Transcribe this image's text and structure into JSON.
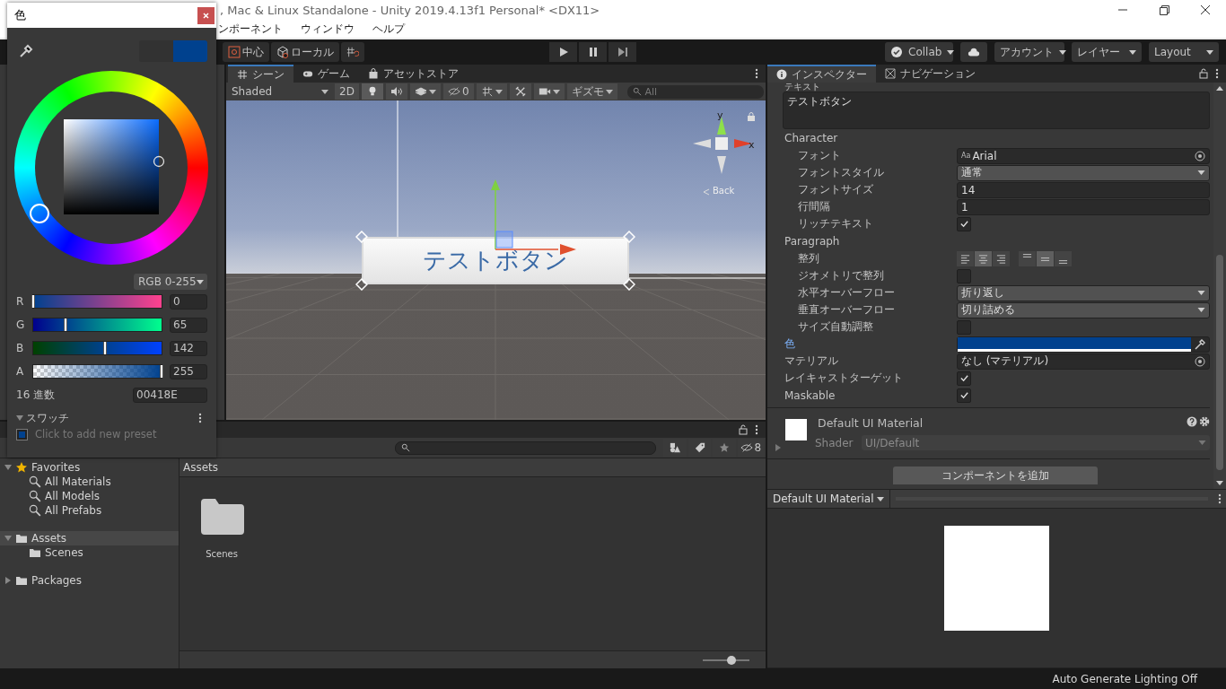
{
  "title_bar": {
    "title": ", Mac & Linux Standalone - Unity 2019.4.13f1 Personal* <DX11>"
  },
  "menu_bar": [
    "ンポーネント",
    "ウィンドウ",
    "ヘルプ"
  ],
  "toolbar": {
    "tools": [
      {
        "label": "中心",
        "kind": "pivot"
      },
      {
        "label": "ローカル",
        "kind": "space"
      }
    ],
    "collab": "Collab",
    "account": "アカウント",
    "layers": "レイヤー",
    "layout": "Layout"
  },
  "scene": {
    "tabs": [
      {
        "label": "シーン",
        "kind": "scene",
        "selected": true
      },
      {
        "label": "ゲーム",
        "kind": "game",
        "selected": false
      },
      {
        "label": "アセットストア",
        "kind": "store",
        "selected": false
      }
    ],
    "shading": "Shaded",
    "mode_2d": "2D",
    "hidden_count": "0",
    "gizmos": "ギズモ",
    "search_placeholder": "All",
    "axis_y": "y",
    "axis_x": "x",
    "view_label": "Back",
    "button_text": "テストボタン"
  },
  "project": {
    "hidden_count": "8",
    "tree": [
      {
        "label": "Favorites",
        "kind": "favorites",
        "expanded": true,
        "selected": false,
        "children": [
          {
            "label": "All Materials",
            "kind": "search",
            "selected": false
          },
          {
            "label": "All Models",
            "kind": "search",
            "selected": false
          },
          {
            "label": "All Prefabs",
            "kind": "search",
            "selected": false
          }
        ]
      },
      {
        "label": "Assets",
        "kind": "folder",
        "expanded": true,
        "selected": true,
        "children": [
          {
            "label": "Scenes",
            "kind": "folder",
            "selected": false
          }
        ]
      },
      {
        "label": "Packages",
        "kind": "folder",
        "expanded": false,
        "selected": false
      }
    ],
    "breadcrumb": "Assets",
    "items": [
      {
        "label": "Scenes"
      }
    ],
    "zoom": {
      "level": 0.62
    }
  },
  "inspector": {
    "tabs": [
      {
        "label": "インスペクター",
        "kind": "info",
        "selected": true
      },
      {
        "label": "ナビゲーション",
        "kind": "nav",
        "selected": false
      }
    ],
    "text_label": "テキスト",
    "text_value": "テストボタン",
    "sections": [
      {
        "title": "Character",
        "rows": [
          {
            "label": "フォント",
            "kind": "object",
            "icon_text": "Aa",
            "value": "Arial"
          },
          {
            "label": "フォントスタイル",
            "kind": "dropdown",
            "value": "通常"
          },
          {
            "label": "フォントサイズ",
            "kind": "field",
            "value": "14"
          },
          {
            "label": "行間隔",
            "kind": "field",
            "value": "1"
          },
          {
            "label": "リッチテキスト",
            "kind": "checkbox",
            "checked": true
          }
        ]
      },
      {
        "title": "Paragraph",
        "rows": [
          {
            "label": "整列",
            "kind": "align",
            "horizontal": [
              {
                "selected": false
              },
              {
                "selected": true
              },
              {
                "selected": false
              }
            ],
            "vertical": [
              {
                "selected": false
              },
              {
                "selected": true
              },
              {
                "selected": false
              }
            ]
          },
          {
            "label": "ジオメトリで整列",
            "kind": "checkbox",
            "checked": false
          },
          {
            "label": "水平オーバーフロー",
            "kind": "dropdown",
            "value": "折り返し"
          },
          {
            "label": "垂直オーバーフロー",
            "kind": "dropdown",
            "value": "切り詰める"
          },
          {
            "label": "サイズ自動調整",
            "kind": "checkbox",
            "checked": false
          }
        ]
      },
      {
        "rows": [
          {
            "label": "色",
            "kind": "color",
            "highlighted": true,
            "color": "#00418e"
          },
          {
            "label": "マテリアル",
            "kind": "object",
            "value": "なし (マテリアル)"
          },
          {
            "label": "レイキャストターゲット",
            "kind": "checkbox",
            "checked": true
          },
          {
            "label": "Maskable",
            "kind": "checkbox",
            "checked": true
          }
        ]
      }
    ],
    "material": {
      "name": "Default UI Material",
      "shader_label": "Shader",
      "shader": "UI/Default"
    },
    "add_component": "コンポーネントを追加",
    "preview": {
      "title": "Default UI Material"
    }
  },
  "status_bar": {
    "text": "Auto Generate Lighting Off"
  },
  "color_picker": {
    "title": "色",
    "preview": [
      {
        "color": "#323232"
      },
      {
        "color": "#00418e"
      }
    ],
    "mode": "RGB 0-255",
    "channels": [
      {
        "name": "R",
        "level": 0,
        "value": "0"
      },
      {
        "name": "G",
        "level": 0.255,
        "value": "65"
      },
      {
        "name": "B",
        "level": 0.557,
        "value": "142"
      },
      {
        "name": "A",
        "level": 1,
        "value": "255"
      }
    ],
    "hex_label": "16 進数",
    "hex": "00418E",
    "swatches_title": "スワッチ",
    "swatches_expanded": true,
    "presets": [
      {
        "color": "#00418e"
      }
    ],
    "add_preset": "Click to add new preset"
  }
}
